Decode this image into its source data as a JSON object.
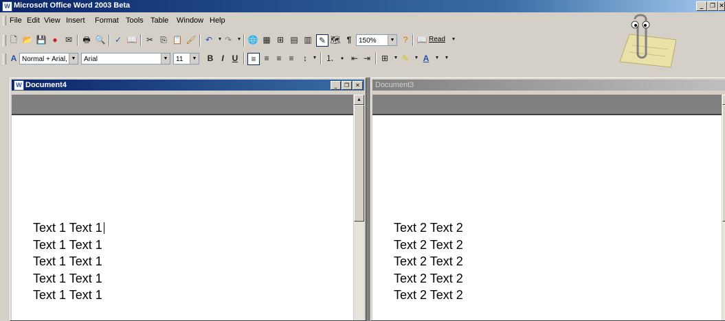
{
  "app": {
    "title": "Microsoft Office Word 2003 Beta"
  },
  "menu": [
    "File",
    "Edit",
    "View",
    "Insert",
    "Format",
    "Tools",
    "Table",
    "Window",
    "Help"
  ],
  "standard_toolbar": {
    "zoom": "150%",
    "read_label": "Read"
  },
  "formatting_toolbar": {
    "style": "Normal + Arial,",
    "font": "Arial",
    "size": "11"
  },
  "doc1": {
    "title": "Document4",
    "lines": [
      "Text 1 Text 1",
      "Text 1 Text 1",
      "Text 1 Text 1",
      "Text 1 Text 1",
      "Text 1 Text 1"
    ]
  },
  "doc2": {
    "title": "Document3",
    "lines": [
      "Text 2 Text 2",
      "Text 2 Text 2",
      "Text 2 Text 2",
      "Text 2 Text 2",
      "Text 2 Text 2"
    ]
  },
  "colors": {
    "titlebar": "#0a246a",
    "face": "#d4d0c8",
    "workspace": "#808080"
  }
}
